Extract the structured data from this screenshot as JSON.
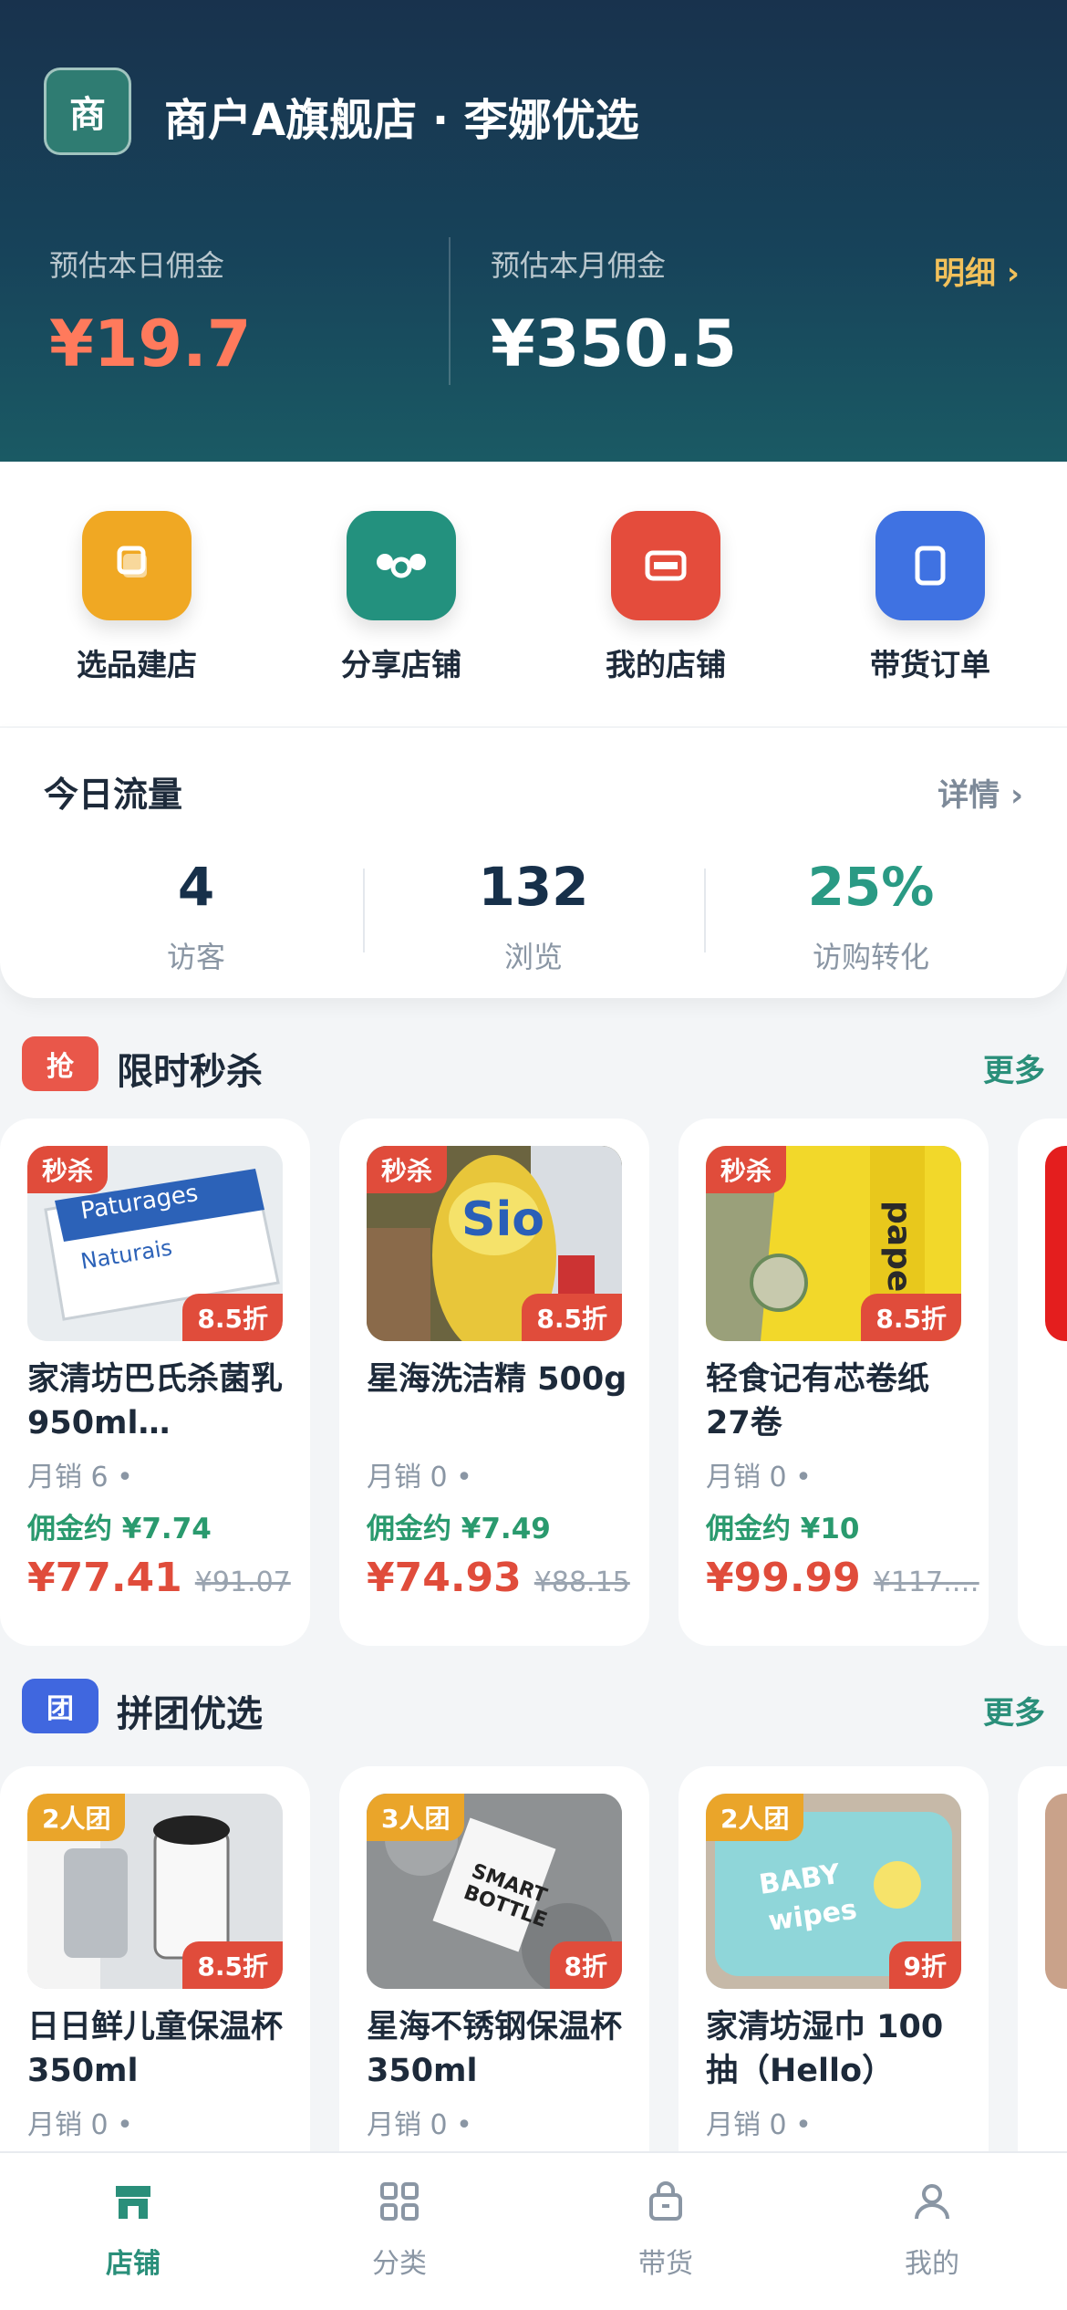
{
  "header": {
    "badge_char": "商",
    "shop_name": "商户A旗舰店 · 李娜优选",
    "today_label": "预估本日佣金",
    "today_value": "¥19.7",
    "month_label": "预估本月佣金",
    "month_value": "¥350.5",
    "detail_label": "明细 ›"
  },
  "actions": [
    {
      "label": "选品建店",
      "color": "#f0a823",
      "icon": "store-build-icon"
    },
    {
      "label": "分享店铺",
      "color": "#23917e",
      "icon": "share-icon"
    },
    {
      "label": "我的店铺",
      "color": "#e44c3c",
      "icon": "shop-icon"
    },
    {
      "label": "带货订单",
      "color": "#3f72e2",
      "icon": "orders-icon"
    }
  ],
  "traffic": {
    "title": "今日流量",
    "more": "详情 ›",
    "stats": [
      {
        "value": "4",
        "caption": "访客"
      },
      {
        "value": "132",
        "caption": "浏览"
      },
      {
        "value": "25%",
        "caption": "访购转化",
        "color": "#2a9a84"
      }
    ]
  },
  "flash": {
    "tag": "抢",
    "title": "限时秒杀",
    "more": "更多",
    "tag_color": "#e9574a",
    "items": [
      {
        "flag": "秒杀",
        "discount": "8.5折",
        "name": "家清坊巴氏杀菌乳 950ml…",
        "sold": "月销 6  •",
        "commission": "佣金约 ¥7.74",
        "price": "¥77.41",
        "orig": "¥91.07",
        "img": "butter"
      },
      {
        "flag": "秒杀",
        "discount": "8.5折",
        "name": "星海洗洁精 500g",
        "sold": "月销 0  •",
        "commission": "佣金约 ¥7.49",
        "price": "¥74.93",
        "orig": "¥88.15",
        "img": "soap"
      },
      {
        "flag": "秒杀",
        "discount": "8.5折",
        "name": "轻食记有芯卷纸 27卷",
        "sold": "月销 0  •",
        "commission": "佣金约 ¥10",
        "price": "¥99.99",
        "orig": "¥117.…",
        "img": "paper"
      }
    ]
  },
  "group": {
    "tag": "团",
    "title": "拼团优选",
    "more": "更多",
    "tag_color": "#4067df",
    "items": [
      {
        "flag": "2人团",
        "discount": "8.5折",
        "name": "日日鲜儿童保温杯 350ml",
        "sold": "月销 0  •",
        "img": "cup"
      },
      {
        "flag": "3人团",
        "discount": "8折",
        "name": "星海不锈钢保温杯 350ml",
        "sold": "月销 0  •",
        "img": "bottle"
      },
      {
        "flag": "2人团",
        "discount": "9折",
        "name": "家清坊湿巾 100抽（Hello）",
        "sold": "月销 0  •",
        "img": "wipes"
      }
    ]
  },
  "tabs": [
    {
      "label": "店铺",
      "icon": "store-icon",
      "active": true
    },
    {
      "label": "分类",
      "icon": "grid-icon",
      "active": false
    },
    {
      "label": "带货",
      "icon": "bag-icon",
      "active": false
    },
    {
      "label": "我的",
      "icon": "user-icon",
      "active": false
    }
  ]
}
